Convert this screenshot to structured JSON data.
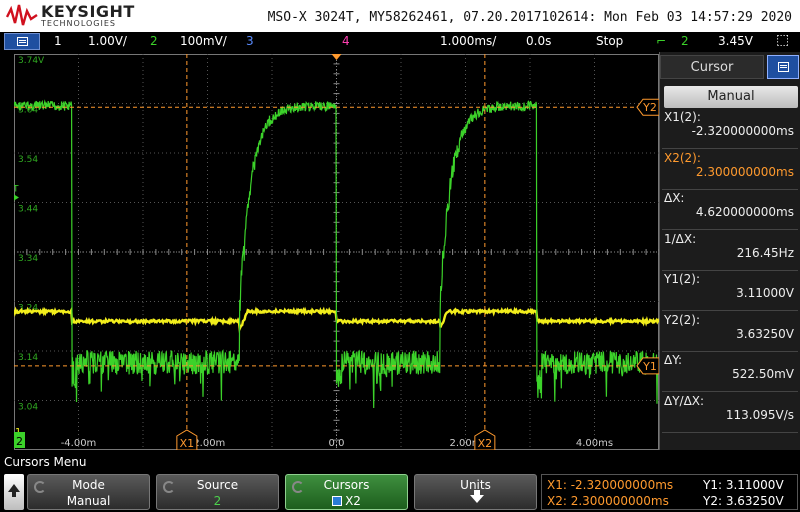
{
  "header": {
    "brand": "KEYSIGHT",
    "brand_sub": "TECHNOLOGIES",
    "info": "MSO-X 3024T, MY58262461, 07.20.2017102614: Mon Feb 03 14:57:29 2020"
  },
  "status": {
    "ch1_num": "1",
    "ch1_scale": "1.00V/",
    "ch2_num": "2",
    "ch2_scale": "100mV/",
    "ch3_num": "3",
    "ch4_num": "4",
    "timebase": "1.000ms/",
    "delay": "0.0s",
    "run_state": "Stop",
    "trig_source": "2",
    "trig_level": "3.45V"
  },
  "colors": {
    "ch1": "#f2ee1c",
    "ch2": "#3cd22a",
    "ch3": "#5a8cff",
    "ch4": "#ff3fb0",
    "cursor": "#ff9a2e",
    "grid": "#9a9a9a"
  },
  "waveform": {
    "y_labels": [
      "3.74V",
      "3.64",
      "3.54",
      "3.44",
      "3.34",
      "3.24",
      "3.14",
      "3.04"
    ],
    "x_labels": [
      "-4.00m",
      "-2.00m",
      "0.0",
      "2.00m",
      "4.00ms"
    ],
    "x_range": [
      -5.0,
      5.0
    ],
    "y_range": [
      3.74,
      2.94
    ],
    "ch2_high_v": 3.635,
    "ch2_low_v": 3.11,
    "ch1_low_v": 3.2,
    "ch1_high_v": 3.22,
    "rising_edges_ms": [
      -1.5,
      1.6
    ],
    "falling_edges_ms": [
      -4.1,
      0.0,
      3.1
    ],
    "cursor_x1_ms": -2.32,
    "cursor_x2_ms": 2.3,
    "cursor_y1_v": 3.11,
    "cursor_y2_v": 3.6325,
    "x1_tag": "X1",
    "x2_tag": "X2",
    "y1_tag": "Y1",
    "y2_tag": "Y2",
    "trig_marker": "T",
    "ch1_marker": "1",
    "ch2_marker": "2"
  },
  "panel": {
    "title": "Cursor",
    "mode": "Manual",
    "items": [
      {
        "label": "X1(2):",
        "value": "-2.320000000ms"
      },
      {
        "label": "X2(2):",
        "value": "2.300000000ms"
      },
      {
        "label": "ΔX:",
        "value": "4.620000000ms"
      },
      {
        "label": "1/ΔX:",
        "value": "216.45Hz"
      },
      {
        "label": "Y1(2):",
        "value": "3.11000V"
      },
      {
        "label": "Y2(2):",
        "value": "3.63250V"
      },
      {
        "label": "ΔY:",
        "value": "522.50mV"
      },
      {
        "label": "ΔY/ΔX:",
        "value": "113.095V/s"
      }
    ]
  },
  "menu": {
    "title": "Cursors Menu",
    "softkeys": [
      {
        "label": "Mode",
        "value": "Manual"
      },
      {
        "label": "Source",
        "value": "2"
      },
      {
        "label": "Cursors",
        "value": "X2"
      },
      {
        "label": "Units",
        "value": ""
      }
    ]
  },
  "readout": {
    "x1": "X1: -2.320000000ms",
    "x2": "X2: 2.300000000ms",
    "y1": "Y1: 3.11000V",
    "y2": "Y2: 3.63250V"
  }
}
